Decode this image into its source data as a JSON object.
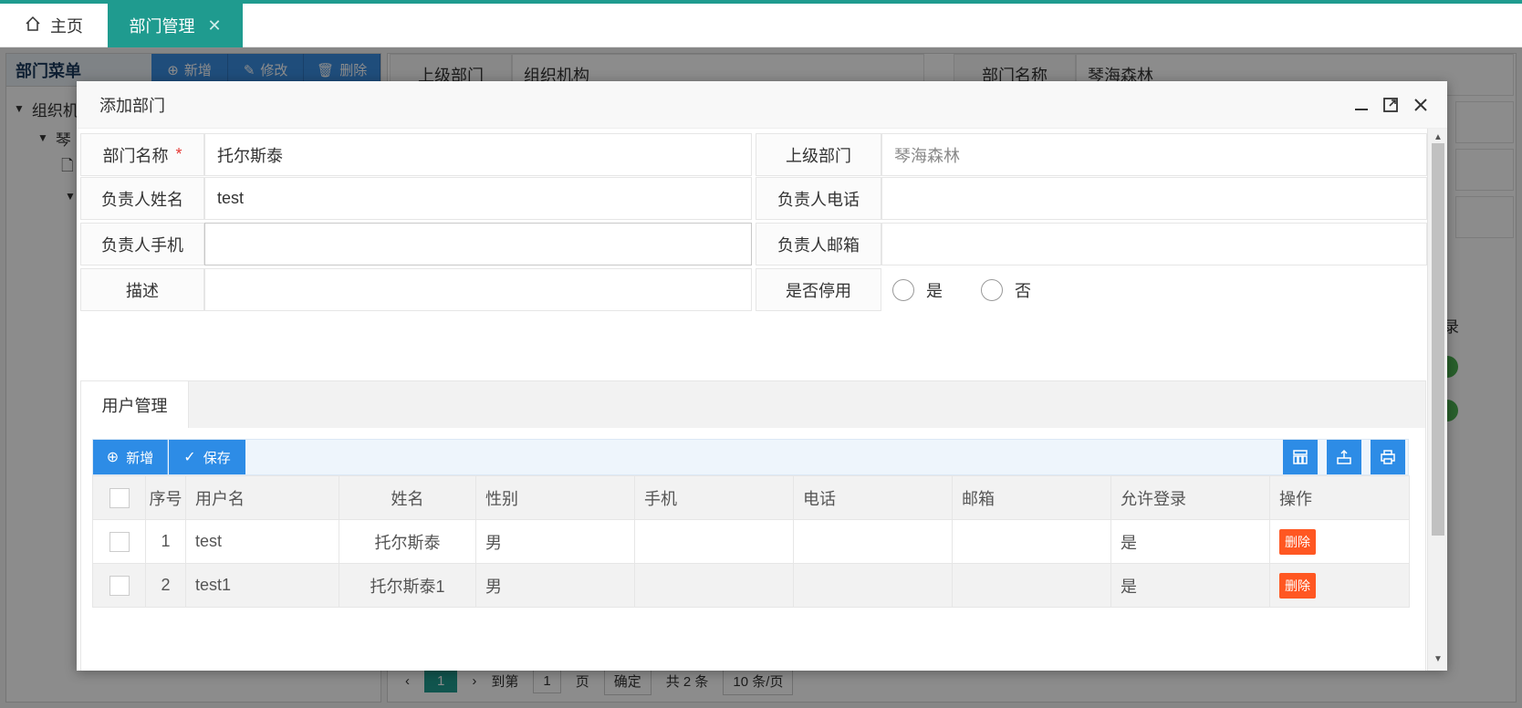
{
  "tabs": {
    "home_label": "主页",
    "active_label": "部门管理",
    "close_glyph": "✕"
  },
  "left_panel": {
    "title": "部门菜单",
    "buttons": {
      "add": "新增",
      "edit": "修改",
      "delete": "删除"
    },
    "tree": [
      "组织机",
      "琴"
    ]
  },
  "right_panel": {
    "parent_dept_label": "上级部门",
    "parent_dept_value": "组织机构",
    "dept_name_label": "部门名称",
    "dept_name_value": "琴海森林",
    "partial_col": "录",
    "pager": {
      "current": "1",
      "goto": "到第",
      "page_input": "1",
      "page_unit": "页",
      "confirm": "确定",
      "total": "共 2 条",
      "per_page": "10 条/页"
    }
  },
  "modal": {
    "title": "添加部门",
    "fields": {
      "dept_name_label": "部门名称",
      "dept_name_required": "*",
      "dept_name_value": "托尔斯泰",
      "parent_label": "上级部门",
      "parent_value": "琴海森林",
      "manager_name_label": "负责人姓名",
      "manager_name_value": "test",
      "manager_phone_label": "负责人电话",
      "manager_phone_value": "",
      "manager_mobile_label": "负责人手机",
      "manager_mobile_value": "",
      "manager_email_label": "负责人邮箱",
      "manager_email_value": "",
      "desc_label": "描述",
      "desc_value": "",
      "disabled_label": "是否停用",
      "disabled_yes": "是",
      "disabled_no": "否"
    },
    "user_tab_label": "用户管理",
    "toolbar": {
      "add": "新增",
      "save": "保存"
    },
    "table": {
      "columns": [
        "序号",
        "用户名",
        "姓名",
        "性别",
        "手机",
        "电话",
        "邮箱",
        "允许登录",
        "操作"
      ],
      "rows": [
        {
          "index": "1",
          "username": "test",
          "name": "托尔斯泰",
          "gender": "男",
          "mobile": "",
          "phone": "",
          "email": "",
          "login": "是",
          "action": "删除"
        },
        {
          "index": "2",
          "username": "test1",
          "name": "托尔斯泰1",
          "gender": "男",
          "mobile": "",
          "phone": "",
          "email": "",
          "login": "是",
          "action": "删除"
        }
      ]
    }
  },
  "colors": {
    "brand_teal": "#1f9b8f",
    "primary_blue": "#2d8ce6",
    "danger_orange": "#ff5722",
    "required_red": "#e53935"
  },
  "icons": {
    "home": "home-icon",
    "close": "close-icon",
    "minimize": "minimize-icon",
    "maximize": "maximize-icon",
    "add": "plus-circle-icon",
    "edit": "pencil-icon",
    "delete": "trash-icon",
    "save": "check-icon",
    "columns": "columns-icon",
    "export": "export-icon",
    "print": "print-icon"
  }
}
